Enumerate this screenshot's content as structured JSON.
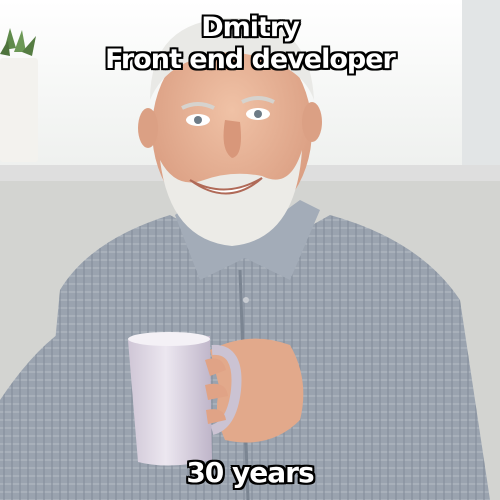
{
  "meme": {
    "top_text": {
      "line1": "Dmitry",
      "line2": "Front end developer"
    },
    "bottom_text": "30 years"
  },
  "colors": {
    "caption_fill": "#ffffff",
    "caption_outline": "#000000",
    "shirt": "#8d97a5",
    "mug": "#dcd6e2",
    "wall": "#ececea"
  }
}
